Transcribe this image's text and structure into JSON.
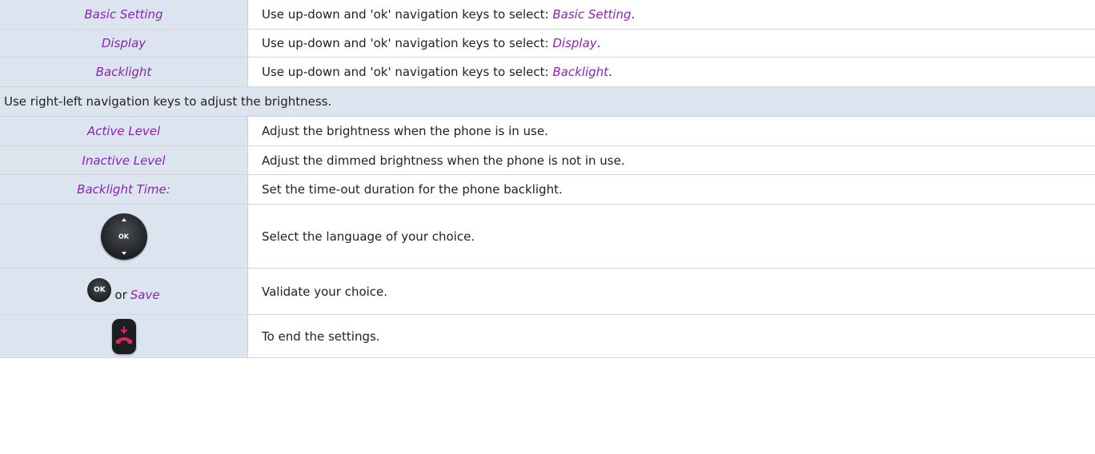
{
  "rows": [
    {
      "left": "Basic Setting",
      "text": "Use up-down and 'ok' navigation keys to select: ",
      "em": "Basic Setting",
      "end": "."
    },
    {
      "left": "Display",
      "text": "Use up-down and 'ok' navigation keys to select: ",
      "em": "Display",
      "end": "."
    },
    {
      "left": "Backlight",
      "text": "Use up-down and 'ok' navigation keys to select: ",
      "em": "Backlight",
      "end": "."
    }
  ],
  "note": "Use right-left navigation keys to adjust the brightness.",
  "levels": [
    {
      "left": "Active Level",
      "text": "Adjust the brightness when the phone is in use."
    },
    {
      "left": "Inactive Level",
      "text": "Adjust the dimmed brightness when the phone is not in use."
    },
    {
      "left": "Backlight Time:",
      "text": "Set the time-out duration for the phone backlight."
    }
  ],
  "keypad": {
    "ok_label": "OK",
    "text": "Select the language of your choice.",
    "icon": "navigation-keypad-icon"
  },
  "validate": {
    "ok_label": "OK",
    "or": "or",
    "save": "Save",
    "text": "Validate your choice.",
    "icon": "ok-button-icon"
  },
  "end": {
    "text": "To end the settings.",
    "icon": "hang-up-key-icon",
    "icon_color": "#e0245e"
  }
}
